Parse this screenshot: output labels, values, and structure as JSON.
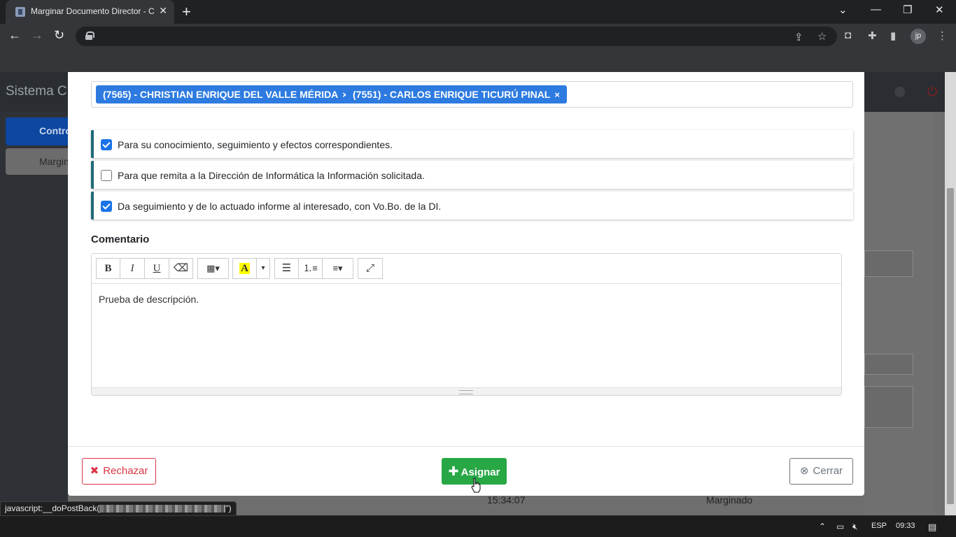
{
  "browser": {
    "tab_title": "Marginar Documento Director - C",
    "tab_close": "✕",
    "new_tab": "+",
    "avatar_initials": "jp"
  },
  "background_page": {
    "brand": "Sistema CD",
    "sidebar_item_1": "Contro",
    "sidebar_item_2": "Margin",
    "table_time": "15:34:07",
    "table_status": "Marginado"
  },
  "modal": {
    "recipients": [
      "(7565) - CHRISTIAN ENRIQUE DEL VALLE MÉRIDA",
      "(7551) - CARLOS ENRIQUE TICURÚ PINAL"
    ],
    "tag_remove": "×",
    "instructions": [
      {
        "label": "Para su conocimiento, seguimiento y efectos correspondientes.",
        "checked": true
      },
      {
        "label": "Para que remita a la Dirección de Informática la Información solicitada.",
        "checked": false
      },
      {
        "label": "Da seguimiento y de lo actuado informe al interesado, con Vo.Bo. de la DI.",
        "checked": true
      }
    ],
    "comment_label": "Comentario",
    "comment_text": "Prueba de descripción.",
    "toolbar": {
      "bold": "B",
      "italic": "I",
      "underline": "U",
      "font_color": "A"
    },
    "buttons": {
      "reject": "Rechazar",
      "assign": "Asignar",
      "close": "Cerrar"
    }
  },
  "status_link": {
    "prefix": "javascript:__doPostBack(",
    "suffix": "\")"
  },
  "taskbar": {
    "language": "ESP",
    "clock": "09:33"
  },
  "colors": {
    "tag_blue": "#2d7be0",
    "assign_green": "#28a745",
    "reject_red": "#dc3545",
    "option_accent": "#1f6b78"
  }
}
